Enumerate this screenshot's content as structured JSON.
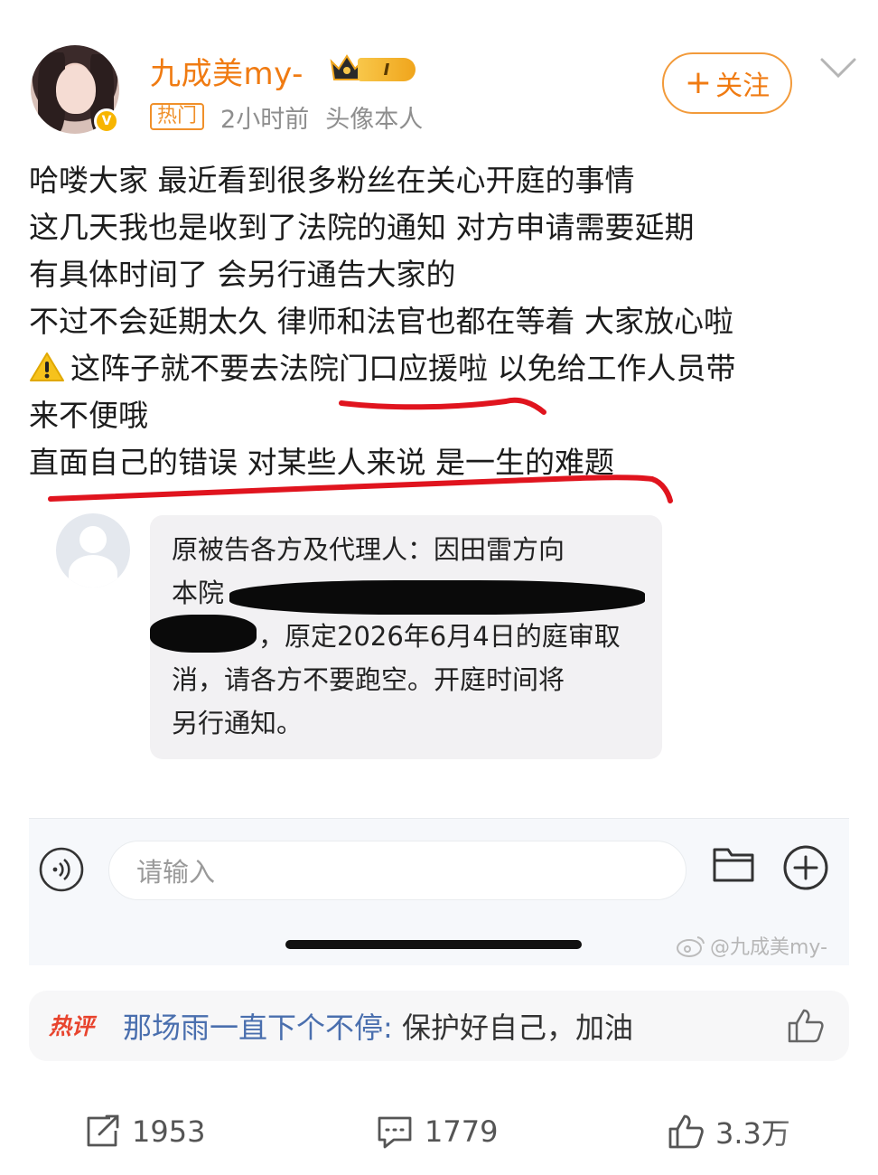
{
  "header": {
    "username": "九成美my-",
    "vip_level": "I",
    "hot_tag": "热门",
    "time": "2小时前",
    "avatar_caption": "头像本人",
    "follow_label": "关注",
    "follow_plus": "+"
  },
  "post": {
    "lines": [
      "哈喽大家 最近看到很多粉丝在关心开庭的事情",
      "这几天我也是收到了法院的通知 对方申请需要延期",
      "有具体时间了 会另行通告大家的",
      "不过不会延期太久 律师和法官也都在等着 大家放心啦",
      "这阵子就不要去法院门口应援啦 以免给工作人员带",
      "来不便哦",
      "直面自己的错误 对某些人来说 是一生的难题"
    ]
  },
  "embed": {
    "message_lines": [
      "原被告各方及代理人：因田雷方向",
      "本院",
      "，原定2026年6月4日的庭审取",
      "消，请各方不要跑空。开庭时间将",
      "另行通知。"
    ],
    "input_placeholder": "请输入",
    "watermark": "@九成美my-"
  },
  "hot_comment": {
    "badge": "热评",
    "user": "那场雨一直下个不停",
    "colon": ":",
    "text": " 保护好自己，加油"
  },
  "actions": {
    "reposts": "1953",
    "comments": "1779",
    "likes": "3.3万"
  },
  "colors": {
    "accent_orange": "#f07b12",
    "annotation_red": "#e0141e",
    "link_blue": "#4a6fae"
  }
}
